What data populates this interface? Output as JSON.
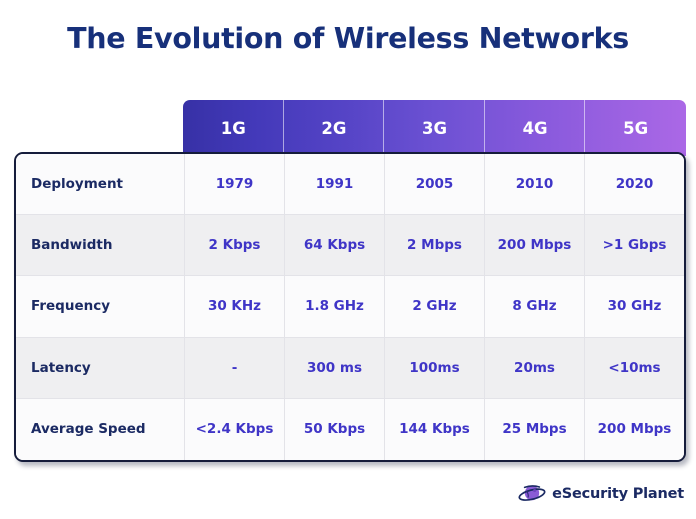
{
  "page": {
    "title": "The Evolution of Wireless Networks",
    "background_color": "#ffffff",
    "title_color": "#17307a"
  },
  "colors": {
    "header_gradient_start": "#3731a6",
    "header_gradient_mid": "#6c51d3",
    "header_gradient_end": "#ab68e6",
    "row_label_text": "#1b2a63",
    "data_text": "#3f35c7",
    "row_alt_background": "#efeff1",
    "row_background": "#fbfbfc",
    "table_border": "#151c3b"
  },
  "logo": {
    "name": "eSecurity Planet",
    "mark": "planet-icon",
    "mark_planet_color": "#8a5cd6",
    "mark_ring_color": "#1b2a63"
  },
  "chart_data": {
    "type": "table",
    "title": "The Evolution of Wireless Networks",
    "xlabel": "",
    "ylabel": "",
    "legend_position": "none",
    "columns": [
      "",
      "1G",
      "2G",
      "3G",
      "4G",
      "5G"
    ],
    "row_headers": [
      "Deployment",
      "Bandwidth",
      "Frequency",
      "Latency",
      "Average Speed"
    ],
    "rows": [
      {
        "label": "Deployment",
        "values": [
          "1979",
          "1991",
          "2005",
          "2010",
          "2020"
        ]
      },
      {
        "label": "Bandwidth",
        "values": [
          "2 Kbps",
          "64 Kbps",
          "2 Mbps",
          "200 Mbps",
          ">1 Gbps"
        ]
      },
      {
        "label": "Frequency",
        "values": [
          "30 KHz",
          "1.8 GHz",
          "2 GHz",
          "8 GHz",
          "30 GHz"
        ]
      },
      {
        "label": "Latency",
        "values": [
          "-",
          "300 ms",
          "100ms",
          "20ms",
          "<10ms"
        ]
      },
      {
        "label": "Average Speed",
        "values": [
          "<2.4 Kbps",
          "50 Kbps",
          "144 Kbps",
          "25 Mbps",
          "200 Mbps"
        ]
      }
    ],
    "series": [
      {
        "name": "Deployment",
        "categories": [
          "1G",
          "2G",
          "3G",
          "4G",
          "5G"
        ],
        "values": [
          1979,
          1991,
          2005,
          2010,
          2020
        ]
      },
      {
        "name": "Bandwidth",
        "categories": [
          "1G",
          "2G",
          "3G",
          "4G",
          "5G"
        ],
        "values": [
          "2 Kbps",
          "64 Kbps",
          "2 Mbps",
          "200 Mbps",
          ">1 Gbps"
        ]
      },
      {
        "name": "Frequency",
        "categories": [
          "1G",
          "2G",
          "3G",
          "4G",
          "5G"
        ],
        "values": [
          "30 KHz",
          "1.8 GHz",
          "2 GHz",
          "8 GHz",
          "30 GHz"
        ]
      },
      {
        "name": "Latency",
        "categories": [
          "1G",
          "2G",
          "3G",
          "4G",
          "5G"
        ],
        "values": [
          "-",
          "300 ms",
          "100ms",
          "20ms",
          "<10ms"
        ]
      },
      {
        "name": "Average Speed",
        "categories": [
          "1G",
          "2G",
          "3G",
          "4G",
          "5G"
        ],
        "values": [
          "<2.4 Kbps",
          "50 Kbps",
          "144 Kbps",
          "25 Mbps",
          "200 Mbps"
        ]
      }
    ]
  }
}
